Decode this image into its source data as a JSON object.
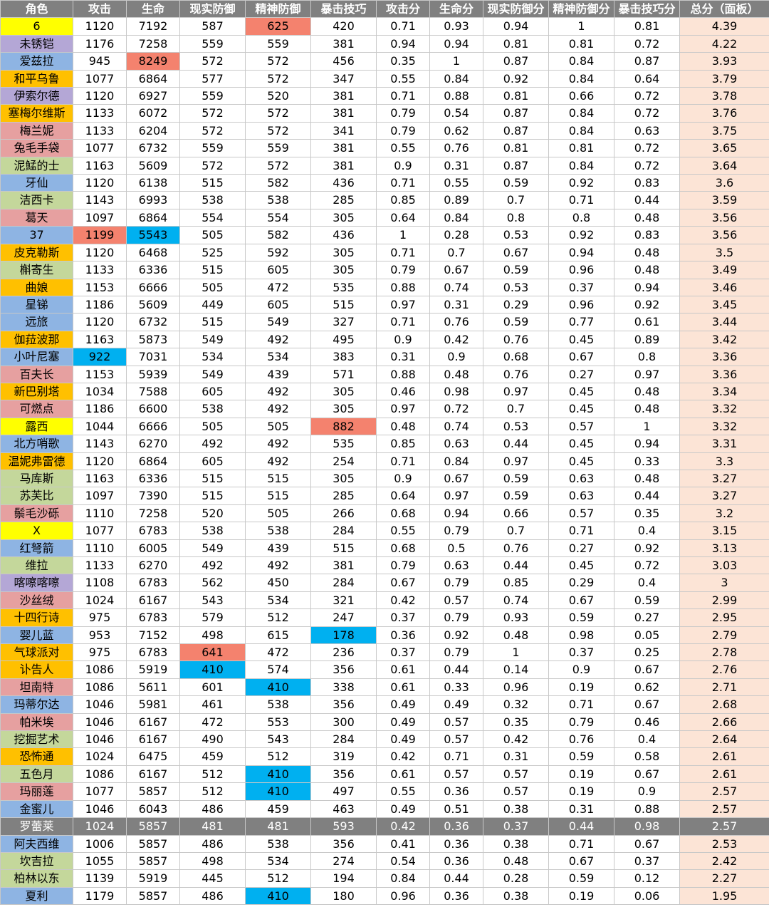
{
  "chart_data": {
    "type": "table",
    "columns": [
      "角色",
      "攻击",
      "生命",
      "现实防御",
      "精神防御",
      "暴击技巧",
      "攻击分",
      "生命分",
      "现实防御分",
      "精神防御分",
      "暴击技巧分",
      "总分（面板）"
    ],
    "rows": [
      [
        "6",
        "1120",
        "7192",
        "587",
        "625",
        "420",
        "0.71",
        "0.93",
        "0.94",
        "1",
        "0.81",
        "4.39"
      ],
      [
        "未锈铠",
        "1176",
        "7258",
        "559",
        "559",
        "381",
        "0.94",
        "0.94",
        "0.81",
        "0.81",
        "0.72",
        "4.22"
      ],
      [
        "爱兹拉",
        "945",
        "8249",
        "572",
        "572",
        "456",
        "0.35",
        "1",
        "0.87",
        "0.84",
        "0.87",
        "3.93"
      ],
      [
        "和平乌鲁",
        "1077",
        "6864",
        "577",
        "572",
        "347",
        "0.55",
        "0.84",
        "0.92",
        "0.84",
        "0.64",
        "3.79"
      ],
      [
        "伊索尔德",
        "1120",
        "6927",
        "559",
        "520",
        "381",
        "0.71",
        "0.88",
        "0.81",
        "0.66",
        "0.72",
        "3.78"
      ],
      [
        "塞梅尔维斯",
        "1133",
        "6072",
        "572",
        "572",
        "381",
        "0.79",
        "0.54",
        "0.87",
        "0.84",
        "0.72",
        "3.76"
      ],
      [
        "梅兰妮",
        "1133",
        "6204",
        "572",
        "572",
        "341",
        "0.79",
        "0.62",
        "0.87",
        "0.84",
        "0.63",
        "3.75"
      ],
      [
        "兔毛手袋",
        "1077",
        "6732",
        "559",
        "559",
        "381",
        "0.55",
        "0.76",
        "0.81",
        "0.81",
        "0.72",
        "3.65"
      ],
      [
        "泥鯭的士",
        "1163",
        "5609",
        "572",
        "572",
        "381",
        "0.9",
        "0.31",
        "0.87",
        "0.84",
        "0.72",
        "3.64"
      ],
      [
        "牙仙",
        "1120",
        "6138",
        "515",
        "582",
        "436",
        "0.71",
        "0.55",
        "0.59",
        "0.92",
        "0.83",
        "3.6"
      ],
      [
        "洁西卡",
        "1143",
        "6993",
        "538",
        "538",
        "285",
        "0.85",
        "0.89",
        "0.7",
        "0.71",
        "0.44",
        "3.59"
      ],
      [
        "葛天",
        "1097",
        "6864",
        "554",
        "554",
        "305",
        "0.64",
        "0.84",
        "0.8",
        "0.8",
        "0.48",
        "3.56"
      ],
      [
        "37",
        "1199",
        "5543",
        "505",
        "582",
        "436",
        "1",
        "0.28",
        "0.53",
        "0.92",
        "0.83",
        "3.56"
      ],
      [
        "皮克勒斯",
        "1120",
        "6468",
        "525",
        "592",
        "305",
        "0.71",
        "0.7",
        "0.67",
        "0.94",
        "0.48",
        "3.5"
      ],
      [
        "槲寄生",
        "1133",
        "6336",
        "515",
        "605",
        "305",
        "0.79",
        "0.67",
        "0.59",
        "0.96",
        "0.48",
        "3.49"
      ],
      [
        "曲娘",
        "1153",
        "6666",
        "505",
        "472",
        "535",
        "0.88",
        "0.74",
        "0.53",
        "0.37",
        "0.94",
        "3.46"
      ],
      [
        "星锑",
        "1186",
        "5609",
        "449",
        "605",
        "515",
        "0.97",
        "0.31",
        "0.29",
        "0.96",
        "0.92",
        "3.45"
      ],
      [
        "远旅",
        "1120",
        "6732",
        "515",
        "549",
        "327",
        "0.71",
        "0.76",
        "0.59",
        "0.77",
        "0.61",
        "3.44"
      ],
      [
        "伽菈波那",
        "1163",
        "5873",
        "549",
        "492",
        "495",
        "0.9",
        "0.42",
        "0.76",
        "0.45",
        "0.89",
        "3.42"
      ],
      [
        "小叶尼塞",
        "922",
        "7031",
        "534",
        "534",
        "383",
        "0.31",
        "0.9",
        "0.68",
        "0.67",
        "0.8",
        "3.36"
      ],
      [
        "百夫长",
        "1153",
        "5939",
        "549",
        "439",
        "571",
        "0.88",
        "0.48",
        "0.76",
        "0.27",
        "0.97",
        "3.36"
      ],
      [
        "新巴别塔",
        "1034",
        "7588",
        "605",
        "492",
        "305",
        "0.46",
        "0.98",
        "0.97",
        "0.45",
        "0.48",
        "3.34"
      ],
      [
        "可燃点",
        "1186",
        "6600",
        "538",
        "492",
        "305",
        "0.97",
        "0.72",
        "0.7",
        "0.45",
        "0.48",
        "3.32"
      ],
      [
        "露西",
        "1044",
        "6666",
        "505",
        "505",
        "882",
        "0.48",
        "0.74",
        "0.53",
        "0.57",
        "1",
        "3.32"
      ],
      [
        "北方哨歌",
        "1143",
        "6270",
        "492",
        "492",
        "535",
        "0.85",
        "0.63",
        "0.44",
        "0.45",
        "0.94",
        "3.31"
      ],
      [
        "温妮弗雷德",
        "1120",
        "6864",
        "605",
        "492",
        "254",
        "0.71",
        "0.84",
        "0.97",
        "0.45",
        "0.33",
        "3.3"
      ],
      [
        "马库斯",
        "1163",
        "6336",
        "515",
        "515",
        "305",
        "0.9",
        "0.67",
        "0.59",
        "0.63",
        "0.48",
        "3.27"
      ],
      [
        "苏芙比",
        "1097",
        "7390",
        "515",
        "515",
        "285",
        "0.64",
        "0.97",
        "0.59",
        "0.63",
        "0.44",
        "3.27"
      ],
      [
        "鬃毛沙砾",
        "1110",
        "7258",
        "520",
        "505",
        "266",
        "0.68",
        "0.94",
        "0.66",
        "0.57",
        "0.35",
        "3.2"
      ],
      [
        "X",
        "1077",
        "6783",
        "538",
        "538",
        "284",
        "0.55",
        "0.79",
        "0.7",
        "0.71",
        "0.4",
        "3.15"
      ],
      [
        "红弩箭",
        "1110",
        "6005",
        "549",
        "439",
        "515",
        "0.68",
        "0.5",
        "0.76",
        "0.27",
        "0.92",
        "3.13"
      ],
      [
        "维拉",
        "1133",
        "6270",
        "492",
        "492",
        "381",
        "0.79",
        "0.63",
        "0.44",
        "0.45",
        "0.72",
        "3.03"
      ],
      [
        "喀嚓喀嚓",
        "1108",
        "6783",
        "562",
        "450",
        "284",
        "0.67",
        "0.79",
        "0.85",
        "0.29",
        "0.4",
        "3"
      ],
      [
        "沙丝绒",
        "1024",
        "6167",
        "543",
        "534",
        "321",
        "0.42",
        "0.57",
        "0.74",
        "0.67",
        "0.59",
        "2.99"
      ],
      [
        "十四行诗",
        "975",
        "6783",
        "579",
        "512",
        "247",
        "0.37",
        "0.79",
        "0.93",
        "0.59",
        "0.27",
        "2.95"
      ],
      [
        "婴儿蓝",
        "953",
        "7152",
        "498",
        "615",
        "178",
        "0.36",
        "0.92",
        "0.48",
        "0.98",
        "0.05",
        "2.79"
      ],
      [
        "气球派对",
        "975",
        "6783",
        "641",
        "472",
        "236",
        "0.37",
        "0.79",
        "1",
        "0.37",
        "0.25",
        "2.78"
      ],
      [
        "讣告人",
        "1086",
        "5919",
        "410",
        "574",
        "356",
        "0.61",
        "0.44",
        "0.14",
        "0.9",
        "0.67",
        "2.76"
      ],
      [
        "坦南特",
        "1086",
        "5611",
        "601",
        "410",
        "338",
        "0.61",
        "0.33",
        "0.96",
        "0.19",
        "0.62",
        "2.71"
      ],
      [
        "玛蒂尔达",
        "1046",
        "5981",
        "461",
        "538",
        "356",
        "0.49",
        "0.49",
        "0.32",
        "0.71",
        "0.67",
        "2.68"
      ],
      [
        "帕米埃",
        "1046",
        "6167",
        "472",
        "553",
        "300",
        "0.49",
        "0.57",
        "0.35",
        "0.79",
        "0.46",
        "2.66"
      ],
      [
        "挖掘艺术",
        "1046",
        "6167",
        "490",
        "543",
        "284",
        "0.49",
        "0.57",
        "0.42",
        "0.76",
        "0.4",
        "2.64"
      ],
      [
        "恐怖通",
        "1024",
        "6475",
        "459",
        "512",
        "319",
        "0.42",
        "0.71",
        "0.31",
        "0.59",
        "0.58",
        "2.61"
      ],
      [
        "五色月",
        "1086",
        "6167",
        "512",
        "410",
        "356",
        "0.61",
        "0.57",
        "0.57",
        "0.19",
        "0.67",
        "2.61"
      ],
      [
        "玛丽莲",
        "1077",
        "5857",
        "512",
        "410",
        "497",
        "0.55",
        "0.36",
        "0.57",
        "0.19",
        "0.9",
        "2.57"
      ],
      [
        "金蜜儿",
        "1046",
        "6043",
        "486",
        "459",
        "463",
        "0.49",
        "0.51",
        "0.38",
        "0.31",
        "0.88",
        "2.57"
      ],
      [
        "罗蕾莱",
        "1024",
        "5857",
        "481",
        "481",
        "593",
        "0.42",
        "0.36",
        "0.37",
        "0.44",
        "0.98",
        "2.57"
      ],
      [
        "阿夫西维",
        "1006",
        "5857",
        "486",
        "538",
        "356",
        "0.41",
        "0.36",
        "0.38",
        "0.71",
        "0.67",
        "2.53"
      ],
      [
        "坎吉拉",
        "1055",
        "5857",
        "498",
        "534",
        "274",
        "0.54",
        "0.36",
        "0.48",
        "0.67",
        "0.37",
        "2.42"
      ],
      [
        "柏林以东",
        "1139",
        "5919",
        "445",
        "512",
        "194",
        "0.84",
        "0.44",
        "0.28",
        "0.59",
        "0.12",
        "2.27"
      ],
      [
        "夏利",
        "1179",
        "5857",
        "486",
        "410",
        "180",
        "0.96",
        "0.36",
        "0.38",
        "0.19",
        "0.06",
        "1.95"
      ]
    ],
    "name_colors": [
      "#ffff00",
      "#b4a7d6",
      "#8eb4e3",
      "#ffc000",
      "#b4a7d6",
      "#ffc000",
      "#e6a0a0",
      "#e6a0a0",
      "#c4d79b",
      "#8eb4e3",
      "#c4d79b",
      "#e6a0a0",
      "#8eb4e3",
      "#ffc000",
      "#c4d79b",
      "#ffc000",
      "#8eb4e3",
      "#8eb4e3",
      "#ffc000",
      "#8eb4e3",
      "#e6a0a0",
      "#ffc000",
      "#e6a0a0",
      "#ffff00",
      "#8eb4e3",
      "#ffc000",
      "#c4d79b",
      "#c4d79b",
      "#e6a0a0",
      "#ffff00",
      "#8eb4e3",
      "#c4d79b",
      "#b4a7d6",
      "#e6a0a0",
      "#ffc000",
      "#8eb4e3",
      "#ffc000",
      "#ffc000",
      "#e6a0a0",
      "#8eb4e3",
      "#e6a0a0",
      "#c4d79b",
      "#ffc000",
      "#c4d79b",
      "#e6a0a0",
      "#8eb4e3",
      "#808080",
      "#8eb4e3",
      "#c4d79b",
      "#c4d79b",
      "#8eb4e3"
    ],
    "highlighted_row": 46,
    "cell_highlights": [
      {
        "row": 0,
        "col": 4,
        "color": "#f4826e"
      },
      {
        "row": 2,
        "col": 2,
        "color": "#f4826e"
      },
      {
        "row": 12,
        "col": 1,
        "color": "#f4826e"
      },
      {
        "row": 12,
        "col": 2,
        "color": "#00b0f0"
      },
      {
        "row": 19,
        "col": 1,
        "color": "#00b0f0"
      },
      {
        "row": 23,
        "col": 5,
        "color": "#f4826e"
      },
      {
        "row": 35,
        "col": 5,
        "color": "#00b0f0"
      },
      {
        "row": 36,
        "col": 3,
        "color": "#f4826e"
      },
      {
        "row": 37,
        "col": 3,
        "color": "#00b0f0"
      },
      {
        "row": 38,
        "col": 4,
        "color": "#00b0f0"
      },
      {
        "row": 43,
        "col": 4,
        "color": "#00b0f0"
      },
      {
        "row": 44,
        "col": 4,
        "color": "#00b0f0"
      },
      {
        "row": 50,
        "col": 4,
        "color": "#00b0f0"
      }
    ],
    "colors": {
      "header_bg": "#808080",
      "header_text": "#ffffff",
      "total_bg": "#fce4d6",
      "highlight_row_bg": "#808080",
      "grid": "#c8c8c8"
    }
  }
}
